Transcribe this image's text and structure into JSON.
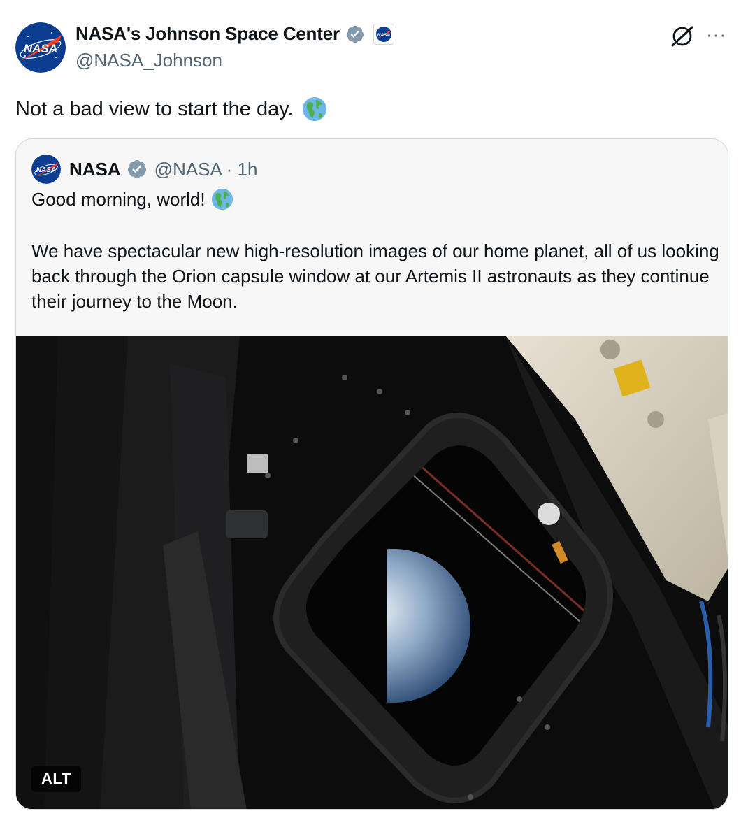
{
  "author": {
    "display_name": "NASA's Johnson Space Center",
    "handle": "@NASA_Johnson",
    "avatar_text": "NASA"
  },
  "post": {
    "text": "Not a bad view to start the day.",
    "emoji": "globe-americas"
  },
  "icons": {
    "verified": "verified-badge-icon",
    "affiliation": "nasa-affiliation-icon",
    "grok": "grok-icon",
    "more": "more-options-icon"
  },
  "quoted": {
    "display_name": "NASA",
    "handle_time": "@NASA · 1h",
    "avatar_text": "NASA",
    "line1": "Good morning, world!",
    "body": "We have spectacular new high-resolution images of our home planet, all of us looking back through the Orion capsule window at our Artemis II astronauts as they continue their journey to the Moon.",
    "media_alt_label": "ALT"
  },
  "colors": {
    "verified": "#829aab",
    "text": "#0f1419",
    "secondary": "#536471",
    "border": "#cfd9de",
    "nasa_blue": "#0b3d91",
    "nasa_red": "#fc3d21"
  },
  "more_glyph": "···"
}
